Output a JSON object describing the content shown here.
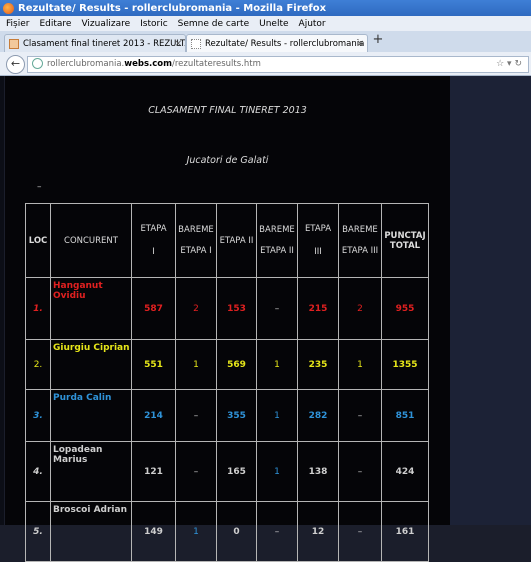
{
  "window": {
    "title": "Rezultate/ Results - rollerclubromania - Mozilla Firefox"
  },
  "menu": [
    "Fișier",
    "Editare",
    "Vizualizare",
    "Istoric",
    "Semne de carte",
    "Unelte",
    "Ajutor"
  ],
  "tabs": [
    {
      "label": "Clasament final tineret 2013 - REZULTAT..."
    },
    {
      "label": "Rezultate/ Results - rollerclubromania"
    }
  ],
  "newtab_label": "+",
  "address": {
    "prefix": "rollerclubromania.",
    "host": "webs.com",
    "path": "/rezultateresults.htm"
  },
  "page": {
    "heading": "CLASAMENT FINAL TINERET 2013",
    "subheading": "Jucatori de Galati",
    "dash": "–"
  },
  "table": {
    "headers": {
      "loc": "LOC",
      "concurent": "CONCURENT",
      "etapa1_a": "ETAPA",
      "etapa1_b": "I",
      "bareme1_a": "BAREME",
      "bareme1_b": "ETAPA I",
      "etapa2": "ETAPA II",
      "bareme2_a": "BAREME",
      "bareme2_b": "ETAPA II",
      "etapa3_a": "ETAPA",
      "etapa3_b": "III",
      "bareme3_a": "BAREME",
      "bareme3_b": "ETAPA III",
      "total_a": "PUNCTAJ",
      "total_b": "TOTAL"
    },
    "rows": [
      {
        "loc": "1.",
        "name": "Hanganut Ovidiu",
        "e1": "587",
        "b1": "2",
        "e2": "153",
        "b2": "–",
        "e3": "215",
        "b3": "2",
        "total": "955",
        "color": "#e02020"
      },
      {
        "loc": "2.",
        "name": "Giurgiu Ciprian",
        "e1": "551",
        "b1": "1",
        "e2": "569",
        "b2": "1",
        "e3": "235",
        "b3": "1",
        "total": "1355",
        "color": "#e6e619"
      },
      {
        "loc": "3.",
        "name": "Purda Calin",
        "e1": "214",
        "b1": "–",
        "e2": "355",
        "b2": "1",
        "e3": "282",
        "b3": "–",
        "total": "851",
        "color": "#2f93d9"
      },
      {
        "loc": "4.",
        "name": "Lopadean Marius",
        "e1": "121",
        "b1": "–",
        "e2": "165",
        "b2": "1",
        "e3": "138",
        "b3": "–",
        "total": "424",
        "color": "#cfcfcf"
      },
      {
        "loc": "5.",
        "name": "Broscoi Adrian",
        "e1": "149",
        "b1": "1",
        "e2": "0",
        "b2": "–",
        "e3": "12",
        "b3": "–",
        "total": "161",
        "color": "#cfcfcf"
      }
    ]
  }
}
